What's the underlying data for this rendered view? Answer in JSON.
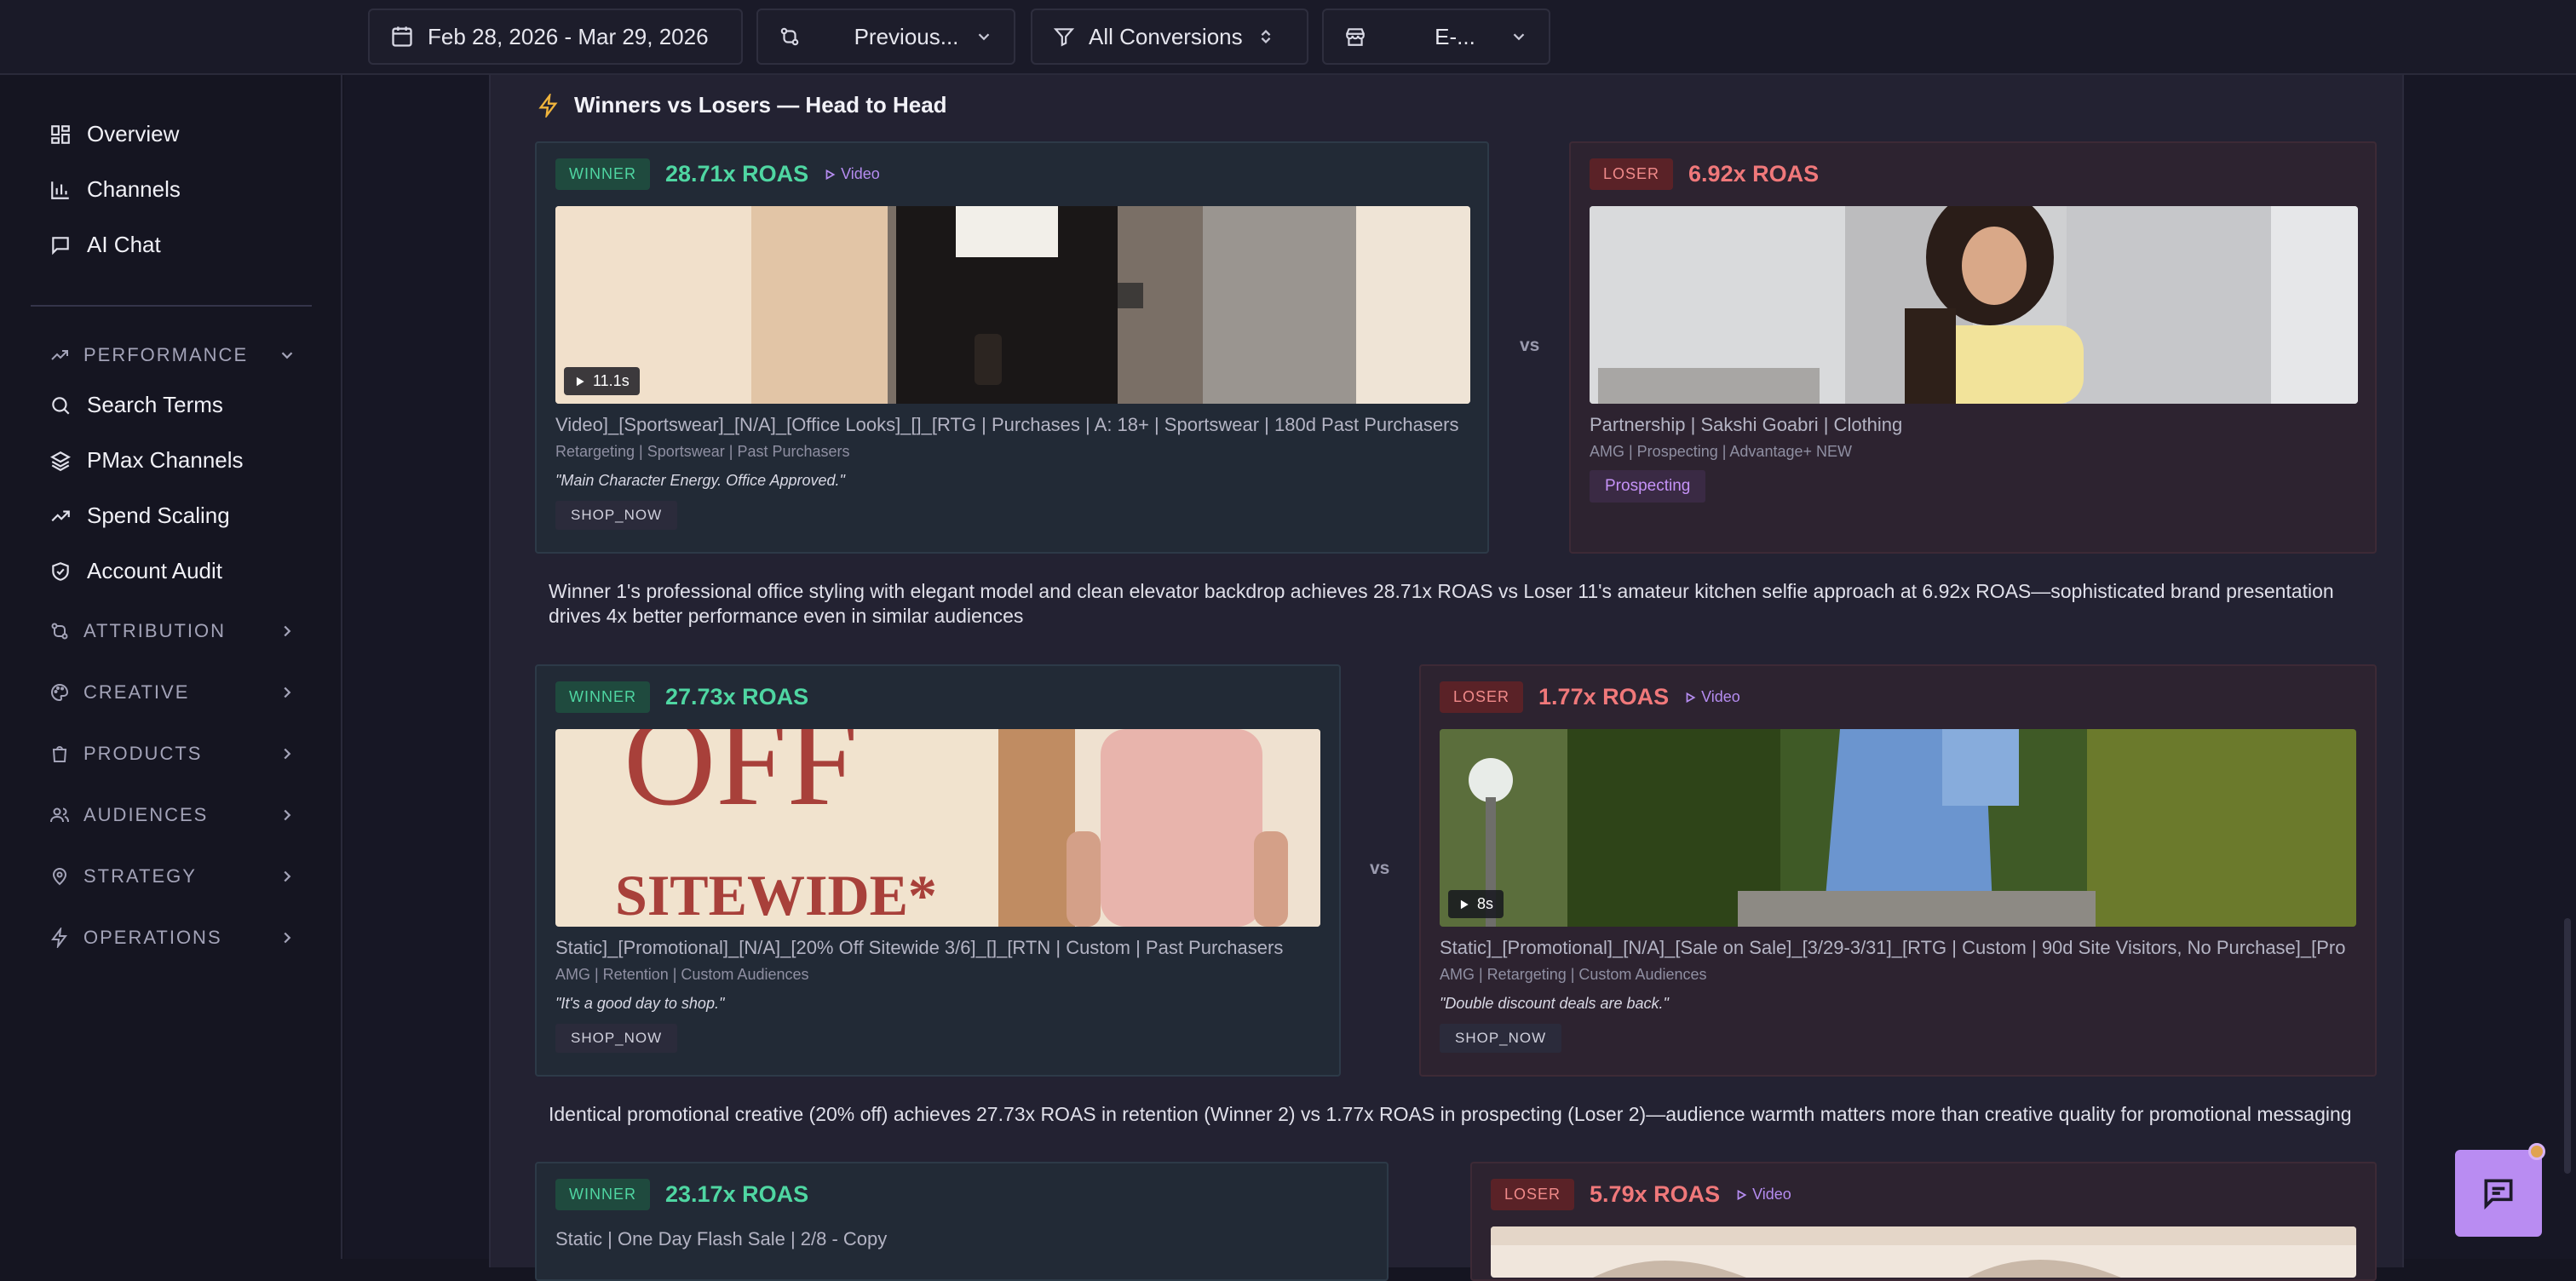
{
  "toolbar": {
    "date_range": "Feb 28, 2026 - Mar 29, 2026",
    "compare": "Previous...",
    "conversions": "All Conversions",
    "store": "E-..."
  },
  "sidebar": {
    "primary": [
      {
        "label": "Overview",
        "icon": "grid-icon"
      },
      {
        "label": "Channels",
        "icon": "bar-chart-icon"
      },
      {
        "label": "AI Chat",
        "icon": "message-icon"
      }
    ],
    "performance": {
      "label": "PERFORMANCE",
      "items": [
        {
          "label": "Search Terms",
          "icon": "search-icon"
        },
        {
          "label": "PMax Channels",
          "icon": "layers-icon"
        },
        {
          "label": "Spend Scaling",
          "icon": "trend-up-icon"
        },
        {
          "label": "Account Audit",
          "icon": "shield-check-icon"
        }
      ]
    },
    "sections": [
      {
        "label": "ATTRIBUTION",
        "icon": "git-compare-icon"
      },
      {
        "label": "CREATIVE",
        "icon": "palette-icon"
      },
      {
        "label": "PRODUCTS",
        "icon": "shopping-bag-icon"
      },
      {
        "label": "AUDIENCES",
        "icon": "users-icon"
      },
      {
        "label": "STRATEGY",
        "icon": "map-pin-icon"
      },
      {
        "label": "OPERATIONS",
        "icon": "zap-icon"
      }
    ]
  },
  "head_to_head": {
    "title": "Winners vs Losers — Head to Head",
    "vs_label": "vs",
    "pairs": [
      {
        "winner": {
          "badge": "WINNER",
          "roas": "28.71x ROAS",
          "format": "Video",
          "duration": "11.1s",
          "name": "Video]_[Sportswear]_[N/A]_[Office Looks]_[]_[RTG | Purchases | A: 18+ | Sportswear | 180d Past Purchasers",
          "meta": "Retargeting | Sportswear | Past Purchasers",
          "quote": "\"Main Character Energy. Office Approved.\"",
          "cta": "SHOP_NOW"
        },
        "loser": {
          "badge": "LOSER",
          "roas": "6.92x ROAS",
          "name": "Partnership | Sakshi Goabri | Clothing",
          "meta": "AMG | Prospecting | Advantage+ NEW",
          "tag": "Prospecting"
        },
        "insight": "Winner 1's professional office styling with elegant model and clean elevator backdrop achieves 28.71x ROAS vs Loser 11's amateur kitchen selfie approach at 6.92x ROAS—sophisticated brand presentation drives 4x better performance even in similar audiences"
      },
      {
        "winner": {
          "badge": "WINNER",
          "roas": "27.73x ROAS",
          "thumb_text_1": "OFF",
          "thumb_text_2": "SITEWIDE*",
          "name": "Static]_[Promotional]_[N/A]_[20% Off Sitewide 3/6]_[]_[RTN | Custom | Past Purchasers",
          "meta": "AMG | Retention | Custom Audiences",
          "quote": "\"It's a good day to shop.\"",
          "cta": "SHOP_NOW"
        },
        "loser": {
          "badge": "LOSER",
          "roas": "1.77x ROAS",
          "format": "Video",
          "duration": "8s",
          "name": "Static]_[Promotional]_[N/A]_[Sale on Sale]_[3/29-3/31]_[RTG | Custom | 90d Site Visitors, No Purchase]_[Pro",
          "meta": "AMG | Retargeting | Custom Audiences",
          "quote": "\"Double discount deals are back.\"",
          "cta": "SHOP_NOW"
        },
        "insight": "Identical promotional creative (20% off) achieves 27.73x ROAS in retention (Winner 2) vs 1.77x ROAS in prospecting (Loser 2)—audience warmth matters more than creative quality for promotional messaging"
      },
      {
        "winner": {
          "badge": "WINNER",
          "roas": "23.17x ROAS",
          "name": "Static | One Day Flash Sale | 2/8 - Copy"
        },
        "loser": {
          "badge": "LOSER",
          "roas": "5.79x ROAS",
          "format": "Video"
        }
      }
    ]
  },
  "colors": {
    "winner": "#4fd6a2",
    "loser": "#f0787a",
    "video_accent": "#b58cf0",
    "chat_button": "#b98cf2"
  }
}
